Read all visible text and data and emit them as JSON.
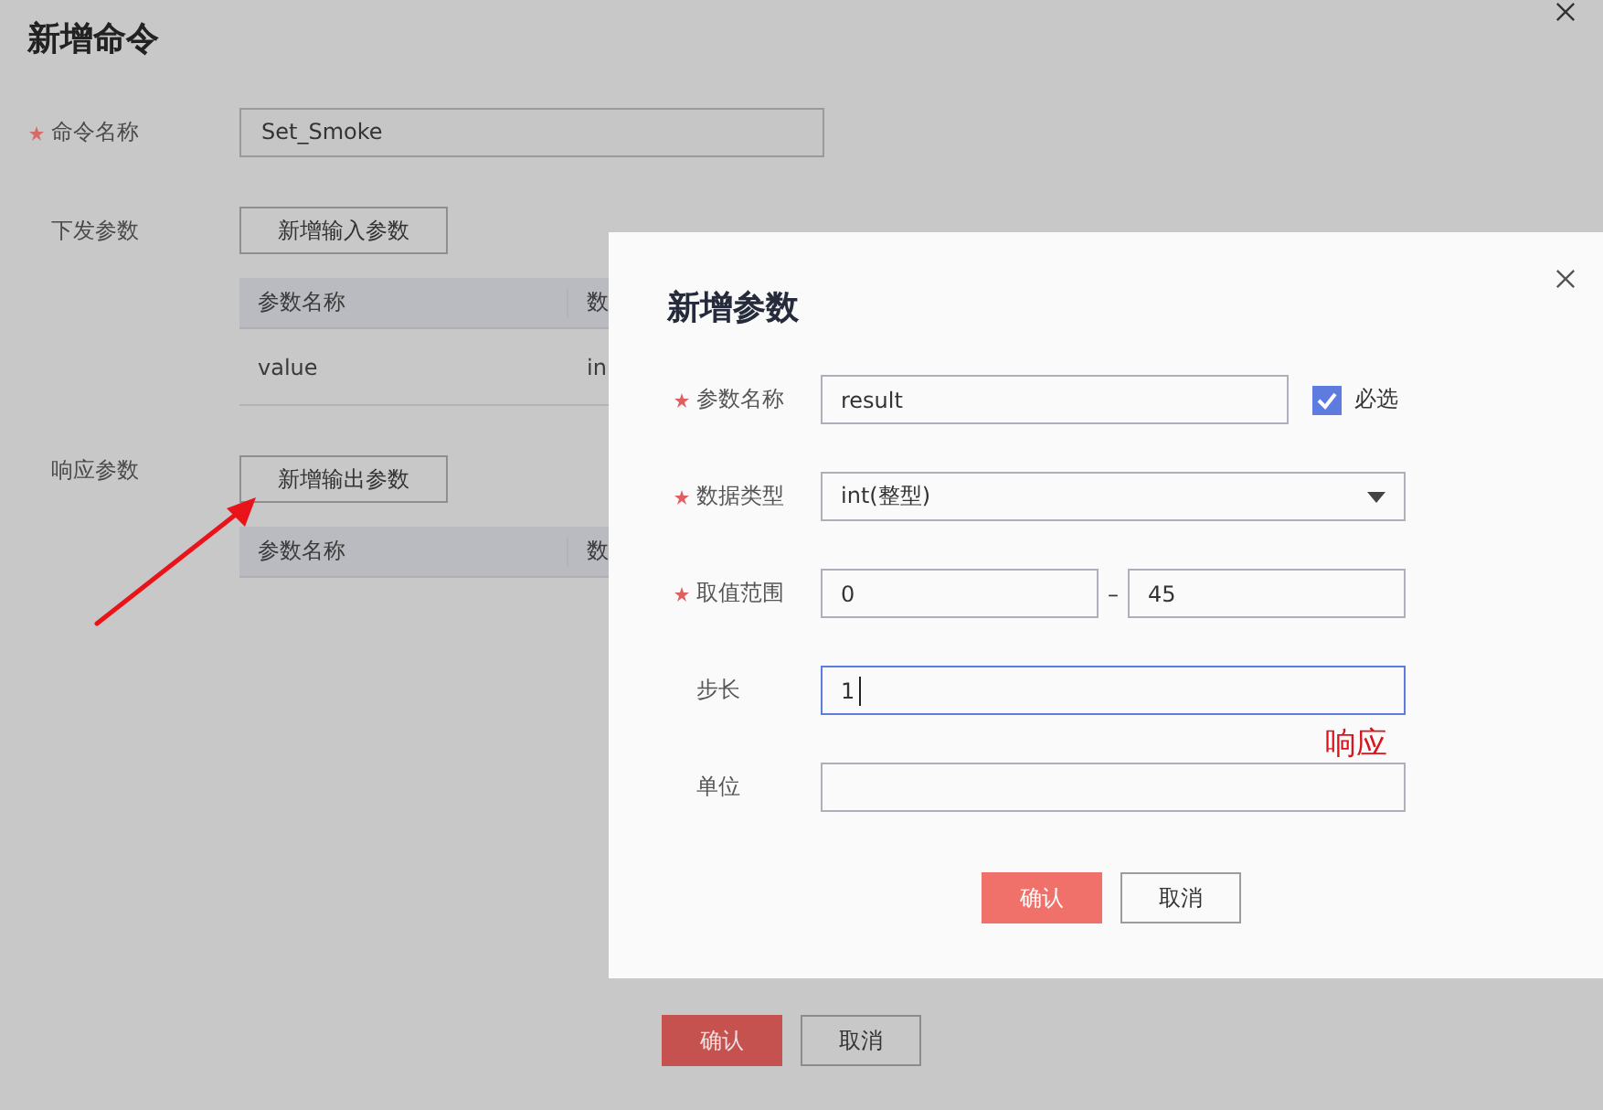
{
  "dialog": {
    "title": "新增命令",
    "name_field": {
      "label": "命令名称",
      "required": true,
      "value": "Set_Smoke"
    },
    "sections": [
      {
        "label": "下发参数",
        "button": "新增输入参数",
        "columns": [
          "参数名称",
          "数"
        ],
        "rows": [
          [
            "value",
            "in"
          ]
        ]
      },
      {
        "label": "响应参数",
        "button": "新增输出参数",
        "columns": [
          "参数名称",
          "数"
        ]
      }
    ],
    "buttons": [
      {
        "label": "确认",
        "kind": "primary"
      },
      {
        "label": "取消",
        "kind": "secondary"
      }
    ]
  },
  "modal": {
    "title": "新增参数",
    "fields": [
      {
        "kind": "text",
        "label": "参数名称",
        "required": true,
        "value": "result",
        "focused": false,
        "checkbox": {
          "label": "必选",
          "checked": true
        }
      },
      {
        "kind": "select",
        "label": "数据类型",
        "required": true,
        "value": "int(整型)"
      },
      {
        "kind": "range",
        "label": "取值范围",
        "required": true,
        "min": "0",
        "separator": "–",
        "max": "45"
      },
      {
        "kind": "text",
        "label": "步长",
        "required": false,
        "value": "1",
        "focused": true
      },
      {
        "kind": "text",
        "label": "单位",
        "required": false,
        "focused": false
      }
    ],
    "buttons": [
      {
        "label": "确认",
        "kind": "primary"
      },
      {
        "label": "取消",
        "kind": "secondary"
      }
    ]
  },
  "annotation": {
    "text": "响应"
  }
}
